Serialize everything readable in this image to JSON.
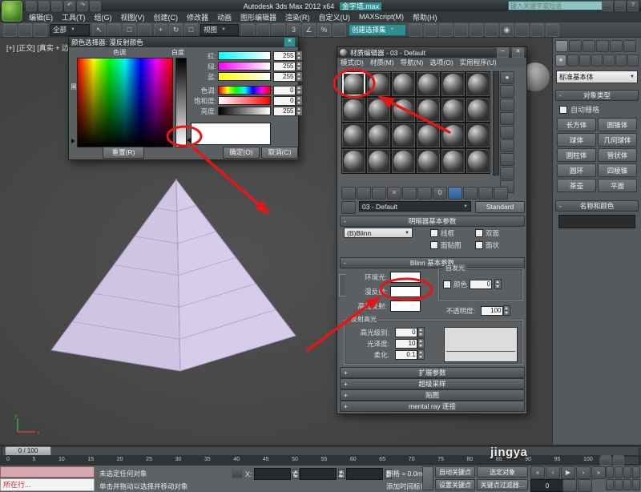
{
  "ui_glyphs": {
    "chevron_down": "▼",
    "close": "✕",
    "minimize": "─",
    "minus": "-",
    "plus": "+"
  },
  "colors": {
    "accent_teal": "#2f8e8e",
    "annotation_red": "#e41717",
    "pyramid_left": "#cfc5e2",
    "pyramid_right": "#d7cce9",
    "diffuse_swatch": "#ffffff"
  },
  "titlebar": {
    "app_title": "Autodesk 3ds Max 2012 x64",
    "filename": "金字塔.max",
    "search_placeholder": "键入关键字或短语",
    "quick_icons": [
      {
        "n": "new-scene-icon"
      },
      {
        "n": "open-file-icon"
      },
      {
        "n": "save-file-icon"
      },
      {
        "n": "undo-icon",
        "g": "↶"
      },
      {
        "n": "redo-icon",
        "g": "↷"
      },
      {
        "n": "project-folder-icon"
      }
    ],
    "info_icons": [
      {
        "n": "sign-in-icon"
      },
      {
        "n": "communication-center-icon"
      },
      {
        "n": "help-icon",
        "g": "?"
      }
    ]
  },
  "menubar": {
    "items": [
      {
        "n": "menu-edit",
        "g": "编辑(E)"
      },
      {
        "n": "menu-tools",
        "g": "工具(T)"
      },
      {
        "n": "menu-group",
        "g": "组(G)"
      },
      {
        "n": "menu-views",
        "g": "视图(V)"
      },
      {
        "n": "menu-create",
        "g": "创建(C)"
      },
      {
        "n": "menu-modifiers",
        "g": "修改器"
      },
      {
        "n": "menu-animation",
        "g": "动画"
      },
      {
        "n": "menu-graph-editors",
        "g": "图形编辑器"
      },
      {
        "n": "menu-rendering",
        "g": "渲染(R)"
      },
      {
        "n": "menu-customize",
        "g": "自定义(U)"
      },
      {
        "n": "menu-maxscript",
        "g": "MAXScript(M)"
      },
      {
        "n": "menu-help",
        "g": "帮助(H)"
      }
    ]
  },
  "toolbar": {
    "group1": [
      {
        "n": "select-and-link-icon"
      },
      {
        "n": "unlink-selection-icon"
      },
      {
        "n": "bind-to-space-warp-icon"
      }
    ],
    "filter_dropdown": "全部",
    "group2": [
      {
        "n": "select-object-icon",
        "g": "↖"
      },
      {
        "n": "select-by-name-icon"
      },
      {
        "n": "rectangular-selection-icon",
        "g": "□"
      },
      {
        "n": "window-crossing-icon"
      }
    ],
    "group3": [
      {
        "n": "select-and-move-icon",
        "g": "+"
      },
      {
        "n": "select-and-rotate-icon",
        "g": "↻"
      },
      {
        "n": "select-and-scale-icon",
        "g": "□"
      }
    ],
    "coord_dropdown": "视图",
    "group4": [
      {
        "n": "use-pivot-point-icon"
      },
      {
        "n": "select-and-manipulate-icon"
      },
      {
        "n": "keyboard-override-icon"
      },
      {
        "n": "snap-toggle-icon",
        "g": "3"
      },
      {
        "n": "angle-snap-icon",
        "g": "∠"
      },
      {
        "n": "percent-snap-icon",
        "g": "%"
      },
      {
        "n": "spinner-snap-icon"
      }
    ],
    "selection_set_dropdown": "创建选择集",
    "group5": [
      {
        "n": "mirror-icon"
      },
      {
        "n": "align-icon"
      },
      {
        "n": "layer-manager-icon"
      },
      {
        "n": "rib​bon-toggle-icon"
      },
      {
        "n": "curve-editor-icon"
      },
      {
        "n": "schematic-view-icon"
      },
      {
        "n": "material-editor-icon",
        "g": "◉"
      },
      {
        "n": "render-setup-icon"
      },
      {
        "n": "rendered-frame-icon"
      },
      {
        "n": "render-production-icon"
      }
    ]
  },
  "viewport": {
    "label": "[+] [正交] [真实 + 边面]",
    "axis_x": "x",
    "axis_y": "y"
  },
  "color_picker": {
    "title": "颜色选择器: 漫反射颜色",
    "hue_label": "色调",
    "whiteness_label": "白度",
    "black_label": "黑",
    "channels": [
      {
        "label": "红:",
        "value": "255"
      },
      {
        "label": "绿:",
        "value": "255"
      },
      {
        "label": "蓝:",
        "value": "255"
      },
      {
        "label": "色调:",
        "value": "0"
      },
      {
        "label": "饱和度:",
        "value": "0"
      },
      {
        "label": "亮度:",
        "value": "255"
      }
    ],
    "reset_button": "重置(R)",
    "ok_button": "确定(O)",
    "cancel_button": "取消(C)"
  },
  "material_editor": {
    "title": "材质编辑器 - 03 - Default",
    "menu": [
      {
        "n": "memenu-modes",
        "g": "模式(D)"
      },
      {
        "n": "memenu-material",
        "g": "材质(M)"
      },
      {
        "n": "memenu-navigation",
        "g": "导航(N)"
      },
      {
        "n": "memenu-options",
        "g": "选项(O)"
      },
      {
        "n": "memenu-utilities",
        "g": "实用程序(U)"
      }
    ],
    "slot_count": 24,
    "vtools": [
      {
        "n": "sample-type-icon",
        "g": "●"
      },
      {
        "n": "backlight-icon"
      },
      {
        "n": "background-icon"
      },
      {
        "n": "sample-uv-tiling-icon"
      },
      {
        "n": "video-color-check-icon"
      },
      {
        "n": "make-preview-icon"
      },
      {
        "n": "material-options-icon"
      },
      {
        "n": "select-by-material-icon"
      },
      {
        "n": "material-map-navigator-icon"
      }
    ],
    "htools": [
      {
        "n": "get-material-icon"
      },
      {
        "n": "put-to-scene-icon"
      },
      {
        "n": "assign-to-selection-icon"
      },
      {
        "n": "reset-map-icon",
        "g": "✕"
      },
      {
        "n": "make-unique-icon"
      },
      {
        "n": "put-to-library-icon"
      },
      {
        "n": "material-id-icon",
        "g": "0"
      },
      {
        "n": "show-map-in-viewport-icon"
      },
      {
        "n": "show-end-result-icon"
      },
      {
        "n": "go-to-parent-icon"
      },
      {
        "n": "go-forward-icon"
      }
    ],
    "material_name_dropdown": "03 - Default",
    "type_button": "Standard",
    "shader_rollout": {
      "title": "明暗器基本参数",
      "dropdown": "(B)Blinn",
      "checkboxes": [
        "线框",
        "双面",
        "面贴图",
        "面状"
      ]
    },
    "blinn_rollout": {
      "title": "Blinn 基本参数",
      "ambient_label": "环境光:",
      "diffuse_label": "漫反射:",
      "specular_label": "高光反射:",
      "selfillum_group": "自发光",
      "color_checkbox": "颜色",
      "selfillum_value": "0",
      "opacity_label": "不透明度:",
      "opacity_value": "100",
      "highlight_group": "反射高光",
      "spec_level_label": "高光级别:",
      "spec_level_value": "0",
      "gloss_label": "光泽度:",
      "gloss_value": "10",
      "soften_label": "柔化:",
      "soften_value": "0.1"
    },
    "rollouts": [
      "扩展参数",
      "超级采样",
      "贴图",
      "mental ray 连接"
    ]
  },
  "command_panel": {
    "tabs": [
      {
        "n": "create-tab-icon"
      },
      {
        "n": "modify-tab-icon"
      },
      {
        "n": "hierarchy-tab-icon"
      },
      {
        "n": "motion-tab-icon"
      },
      {
        "n": "display-tab-icon"
      },
      {
        "n": "utilities-tab-icon"
      }
    ],
    "categories": [
      {
        "n": "geometry-category-icon",
        "g": "●"
      },
      {
        "n": "shapes-category-icon"
      },
      {
        "n": "lights-category-icon"
      },
      {
        "n": "cameras-category-icon"
      },
      {
        "n": "helpers-category-icon"
      },
      {
        "n": "space-warps-category-icon"
      },
      {
        "n": "systems-category-icon"
      }
    ],
    "category_dropdown": "标准基本体",
    "object_type_title": "对象类型",
    "autogrid_label": "自动栅格",
    "buttons": [
      {
        "n": "box-button",
        "g": "长方体"
      },
      {
        "n": "cone-button",
        "g": "圆锥体"
      },
      {
        "n": "sphere-button",
        "g": "球体"
      },
      {
        "n": "geosphere-button",
        "g": "几何球体"
      },
      {
        "n": "cylinder-button",
        "g": "圆柱体"
      },
      {
        "n": "tube-button",
        "g": "管状体"
      },
      {
        "n": "torus-button",
        "g": "圆环"
      },
      {
        "n": "pyramid-button",
        "g": "四棱锥"
      },
      {
        "n": "teapot-button",
        "g": "茶壶"
      },
      {
        "n": "plane-button",
        "g": "平面"
      }
    ],
    "name_color_title": "名称和颜色"
  },
  "timeline": {
    "handle": "0 / 100",
    "ticks": [
      "0",
      "5",
      "10",
      "15",
      "20",
      "25",
      "30",
      "35",
      "40",
      "45",
      "50",
      "55",
      "60",
      "65",
      "70",
      "75",
      "80",
      "85",
      "90",
      "95",
      "100"
    ]
  },
  "statusbar": {
    "listener_text": "所在行...",
    "status": "未选定任何对象",
    "prompt": "单击并拖动以选择并移动对象",
    "x_label": "X:",
    "y_label": "Y:",
    "z_label": "Z:",
    "grid": "栅格 = 0.0mm",
    "time_tag": "添加时间标记",
    "auto_key": "自动关键点",
    "selected_dropdown": "选定对象",
    "set_key": "设置关键点",
    "key_filters": "关键点过滤器...",
    "frame_value": "0",
    "playback": [
      {
        "n": "go-to-start-icon",
        "g": "«"
      },
      {
        "n": "previous-frame-icon",
        "g": "‹"
      },
      {
        "n": "play-icon",
        "g": "▶"
      },
      {
        "n": "next-frame-icon",
        "g": "›"
      },
      {
        "n": "go-to-end-icon",
        "g": "»"
      }
    ],
    "extra": [
      {
        "n": "key-mode-toggle-icon"
      },
      {
        "n": "time-configuration-icon"
      }
    ],
    "nav_icons": [
      {
        "n": "zoom-icon"
      },
      {
        "n": "zoom-all-icon"
      },
      {
        "n": "zoom-extents-icon"
      },
      {
        "n": "zoom-region-icon"
      },
      {
        "n": "pan-icon"
      },
      {
        "n": "orbit-icon"
      },
      {
        "n": "maximize-viewport-icon"
      },
      {
        "n": "field-of-view-icon"
      }
    ]
  },
  "watermark": "jingya"
}
